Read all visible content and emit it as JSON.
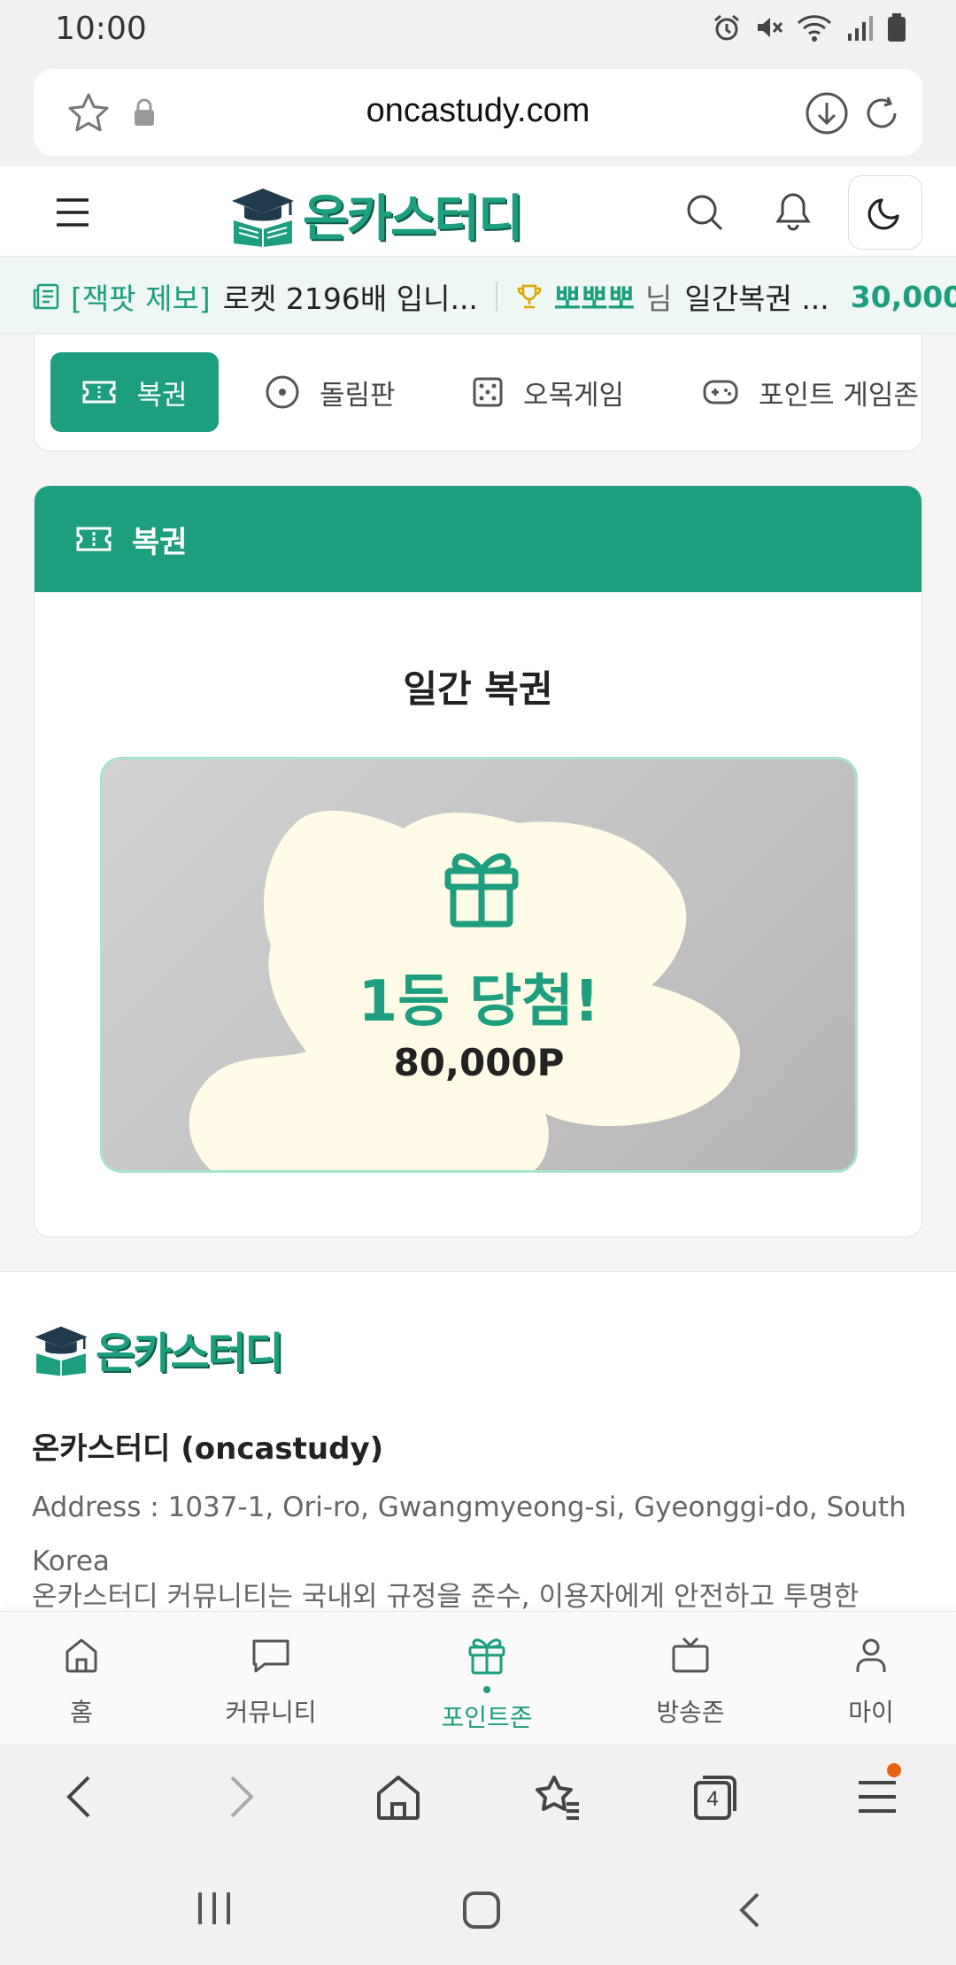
{
  "status_bar": {
    "time": "10:00"
  },
  "browser": {
    "url": "oncastudy.com",
    "tabs_count": "4"
  },
  "site": {
    "logo_text": "온카스터디"
  },
  "ticker": {
    "tag": "[잭팟 제보]",
    "text": "로켓 2196배 입니...",
    "user": "뽀뽀뽀",
    "nim": "님",
    "event": "일간복권 ...",
    "amount": "30,000P"
  },
  "tabs": [
    {
      "label": "복권",
      "icon": "ticket-icon",
      "active": true
    },
    {
      "label": "돌림판",
      "icon": "roulette-icon"
    },
    {
      "label": "오목게임",
      "icon": "dice-icon"
    },
    {
      "label": "포인트 게임존",
      "icon": "gamepad-icon"
    }
  ],
  "lottery": {
    "header": "복권",
    "title": "일간 복권",
    "prize_title": "1등 당첨!",
    "prize_amount": "80,000P"
  },
  "footer": {
    "company": "온카스터디 (oncastudy)",
    "address": "Address : 1037-1, Ori-ro, Gwangmyeong-si, Gyeonggi-do, South Korea",
    "description": "온카스터디 커뮤니티는 국내외 규정을 준수, 이용자에게 안전하고 투명한"
  },
  "bottom_nav": [
    {
      "label": "홈",
      "icon": "home-icon"
    },
    {
      "label": "커뮤니티",
      "icon": "chat-icon"
    },
    {
      "label": "포인트존",
      "icon": "gift-icon",
      "active": true
    },
    {
      "label": "방송존",
      "icon": "tv-icon"
    },
    {
      "label": "마이",
      "icon": "user-icon"
    }
  ],
  "colors": {
    "accent": "#1d9e7e",
    "ticker_bg": "#eef7f3",
    "scratch_highlight": "#fffbe6",
    "notification_dot": "#e8630f"
  }
}
